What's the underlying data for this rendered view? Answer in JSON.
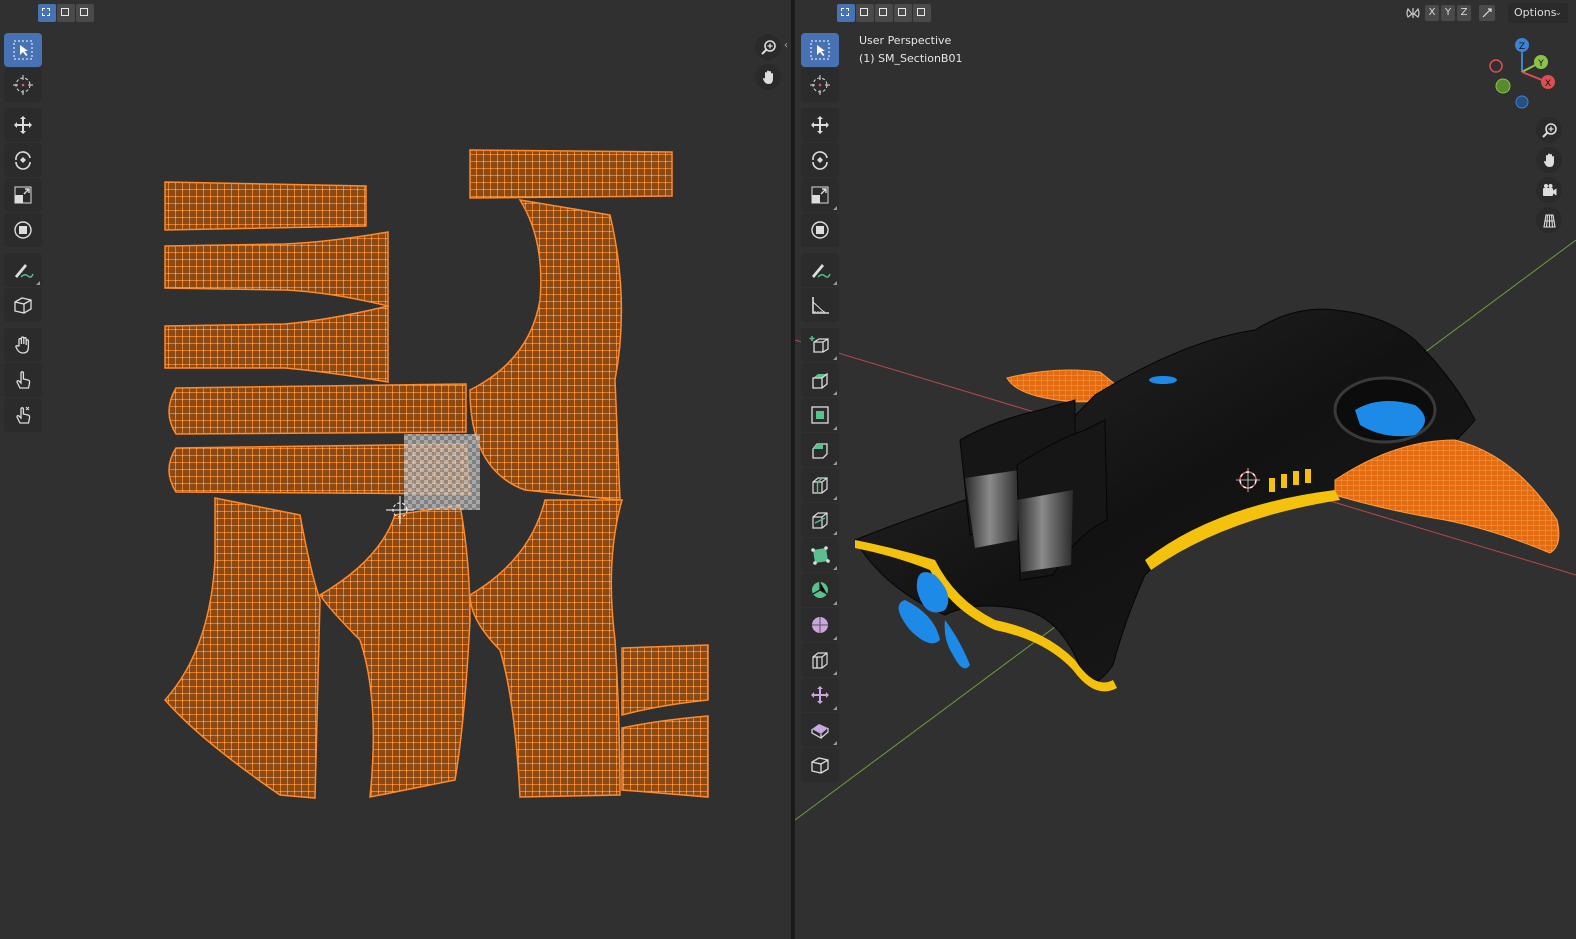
{
  "uv_editor": {
    "header": {
      "select_modes": [
        "select-new-icon",
        "select-extend-icon",
        "select-subtract-icon"
      ]
    },
    "tools": [
      "select-box-icon",
      "cursor-icon",
      "move-icon",
      "rotate-icon",
      "scale-icon",
      "transform-icon",
      "annotate-icon",
      "rip-region-icon",
      "grab-icon",
      "relax-icon",
      "pinch-icon"
    ],
    "nav": [
      "zoom-icon",
      "hand-pan-icon"
    ],
    "island_color": "#f07a1e"
  },
  "viewport_3d": {
    "header": {
      "select_modes": [
        "select-new-icon",
        "select-extend-icon",
        "select-subtract-icon",
        "select-invert-icon",
        "select-intersect-icon"
      ],
      "mirror_axes": [
        "X",
        "Y",
        "Z"
      ],
      "options_label": "Options"
    },
    "view_name": "User Perspective",
    "object_info": "(1) SM_SectionB01",
    "tools": [
      "select-box-icon",
      "cursor-icon",
      "move-icon",
      "rotate-icon",
      "scale-icon",
      "transform-icon",
      "annotate-icon",
      "measure-icon",
      "add-cube-icon",
      "extrude-icon",
      "inset-icon",
      "bevel-icon",
      "loop-cut-icon",
      "knife-icon",
      "poly-build-icon",
      "spin-icon",
      "smooth-icon",
      "edge-slide-icon",
      "shrink-fatten-icon",
      "shear-icon",
      "rip-icon"
    ],
    "nav": [
      "zoom-icon",
      "hand-pan-icon",
      "camera-icon",
      "grid-view-icon"
    ],
    "gizmo_axes": [
      "X",
      "Y",
      "Z"
    ],
    "colors": {
      "x_axis": "#d94f52",
      "y_axis": "#8bc34a",
      "z_axis": "#3c83d4",
      "model_body": "#141414",
      "trim": "#f4c20d",
      "accent_blue": "#1e8ae8"
    }
  }
}
